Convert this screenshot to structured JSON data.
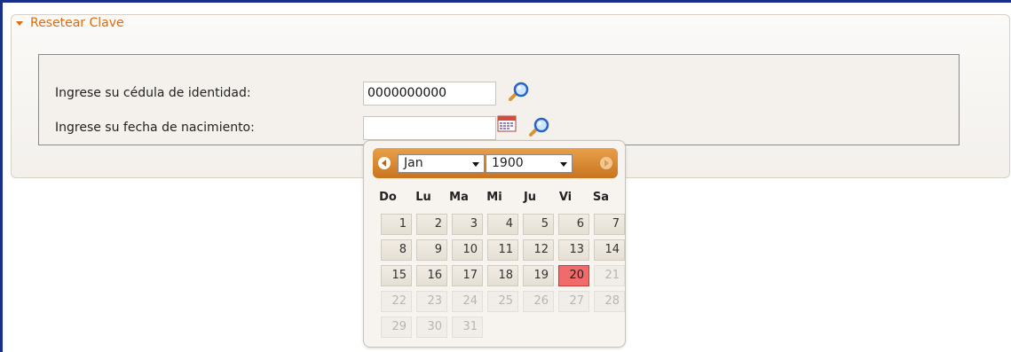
{
  "panel": {
    "title": "Resetear Clave"
  },
  "form": {
    "cedula_label": "Ingrese su cédula de identidad:",
    "cedula_value": "0000000000",
    "fecha_label": "Ingrese su fecha de nacimiento:",
    "fecha_value": ""
  },
  "datepicker": {
    "month": "Jan",
    "year": "1900",
    "weekdays": [
      "Do",
      "Lu",
      "Ma",
      "Mi",
      "Ju",
      "Vi",
      "Sa"
    ],
    "days": [
      [
        "1",
        "2",
        "3",
        "4",
        "5",
        "6",
        "7"
      ],
      [
        "8",
        "9",
        "10",
        "11",
        "12",
        "13",
        "14"
      ],
      [
        "15",
        "16",
        "17",
        "18",
        "19",
        "20",
        "21"
      ],
      [
        "22",
        "23",
        "24",
        "25",
        "26",
        "27",
        "28"
      ],
      [
        "29",
        "30",
        "31"
      ]
    ],
    "selected_day": "20",
    "last_enabled_day": "20"
  },
  "colors": {
    "accent": "#e06a0c",
    "header_orange": "#c9741d",
    "selected_day": "#f06b6b",
    "frame_blue": "#1a2f8c"
  },
  "icons": [
    "magnifier-icon",
    "calendar-icon",
    "prev-month-icon",
    "next-month-icon",
    "caret-down-icon"
  ]
}
